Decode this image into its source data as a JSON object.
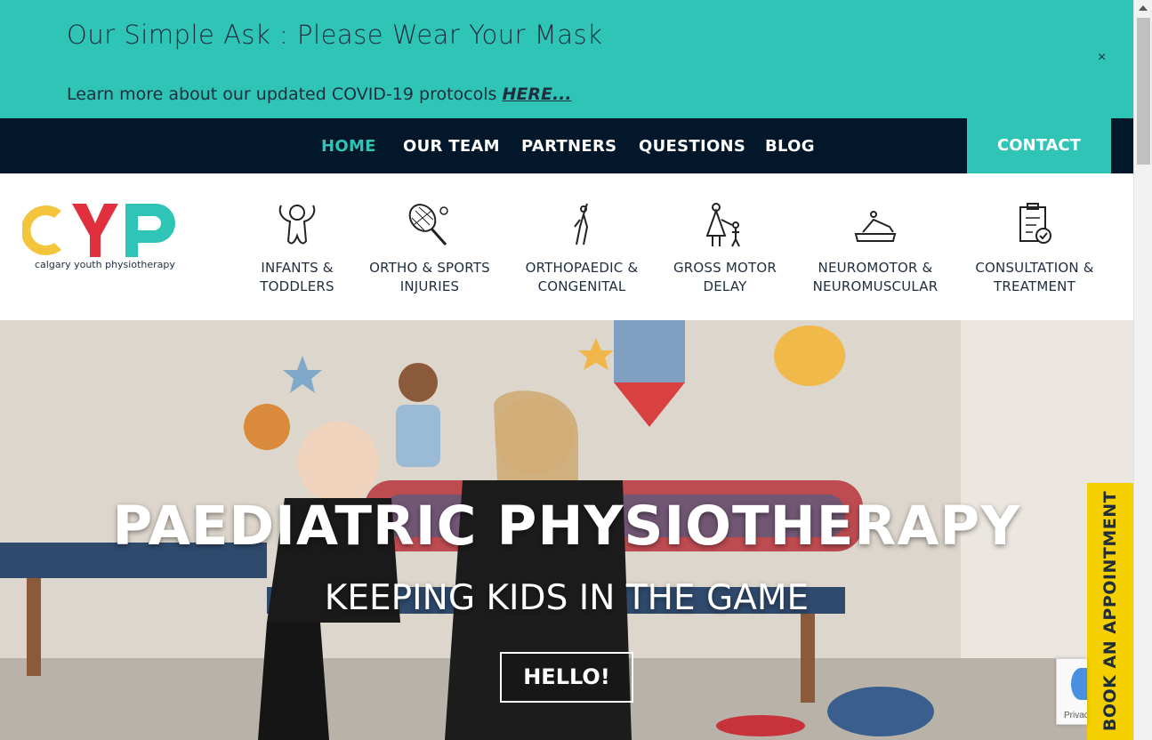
{
  "announcement": {
    "title": "Our Simple Ask : Please Wear Your Mask",
    "text": "Learn more about our updated COVID-19 protocols ",
    "link": "HERE...",
    "close": "×"
  },
  "nav": {
    "items": [
      "HOME",
      "OUR TEAM",
      "PARTNERS",
      "QUESTIONS",
      "BLOG"
    ],
    "active": "HOME",
    "contact": "CONTACT"
  },
  "logo": {
    "letters": "CYP",
    "tagline": "calgary youth physiotherapy"
  },
  "services": [
    {
      "line1": "INFANTS &",
      "line2": "TODDLERS",
      "icon": "infant-icon"
    },
    {
      "line1": "ORTHO & SPORTS",
      "line2": "INJURIES",
      "icon": "tennis-racket-icon"
    },
    {
      "line1": "ORTHOPAEDIC &",
      "line2": "CONGENITAL",
      "icon": "figure-stretch-icon"
    },
    {
      "line1": "GROSS MOTOR",
      "line2": "DELAY",
      "icon": "parent-child-icon"
    },
    {
      "line1": "NEUROMOTOR &",
      "line2": "NEUROMUSCULAR",
      "icon": "reclining-patient-icon"
    },
    {
      "line1": "CONSULTATION &",
      "line2": "TREATMENT",
      "icon": "clipboard-check-icon"
    }
  ],
  "hero": {
    "title": "PAEDIATRIC PHYSIOTHERAPY",
    "subtitle": "KEEPING KIDS IN THE GAME",
    "button": "HELLO!"
  },
  "book": "BOOK AN APPOINTMENT",
  "recaptcha": "Privacy",
  "colors": {
    "teal": "#2ec4b6",
    "navy": "#02172a",
    "yellow": "#f5d000",
    "logo_yellow": "#f2c53d",
    "logo_red": "#e0303e",
    "logo_teal": "#2ec4b6"
  }
}
